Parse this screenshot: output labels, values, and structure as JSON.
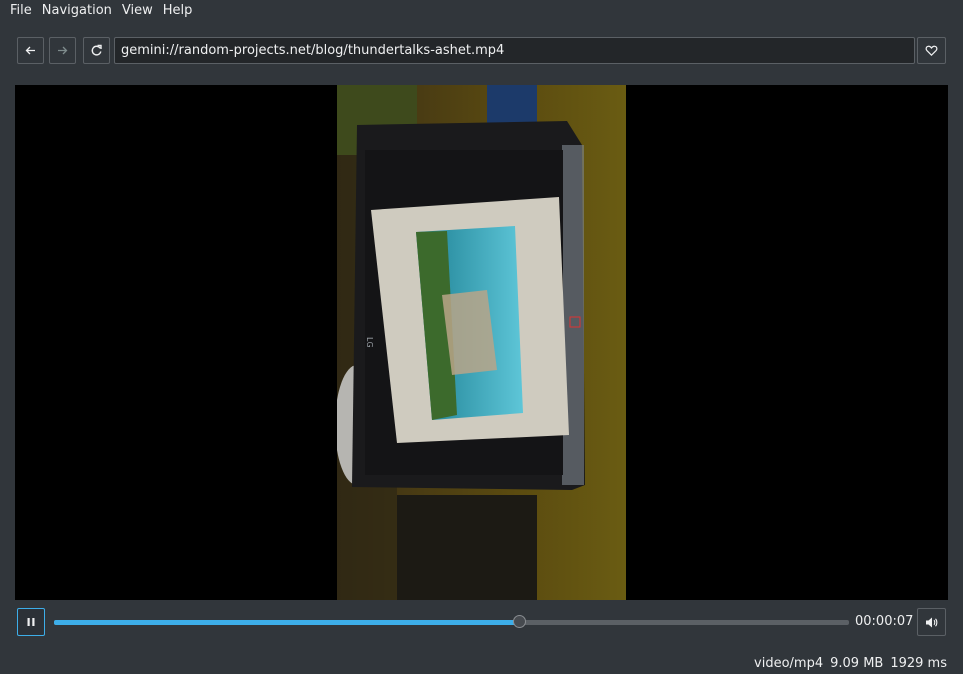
{
  "menu": {
    "items": [
      "File",
      "Navigation",
      "View",
      "Help"
    ]
  },
  "toolbar": {
    "back_icon": "arrow-left-icon",
    "forward_icon": "arrow-right-icon",
    "reload_icon": "reload-icon",
    "url": "gemini://random-projects.net/blog/thundertalks-ashet.mp4",
    "bookmark_icon": "heart-icon"
  },
  "player": {
    "state": "playing",
    "pause_icon": "pause-icon",
    "progress": 0.586,
    "time": "00:00:07",
    "volume_icon": "speaker-icon"
  },
  "status": {
    "mime": "video/mp4",
    "size": "9.09 MB",
    "load_time": "1929 ms"
  },
  "colors": {
    "background": "#31363b",
    "accent": "#3daee9",
    "field": "#232629"
  }
}
